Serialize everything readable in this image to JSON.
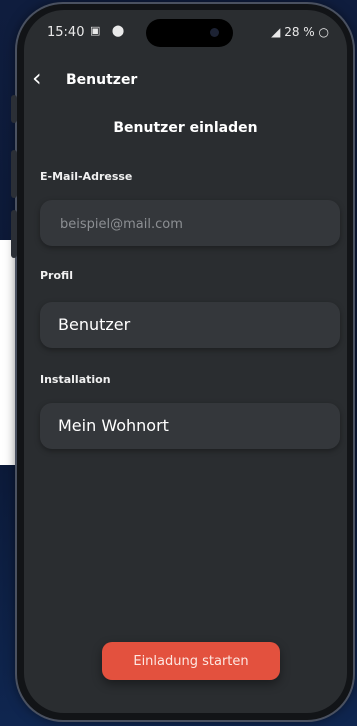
{
  "status": {
    "time": "15:40",
    "left_icons": "▣ ⬤",
    "signal_battery": "◢ 28 % ○"
  },
  "header": {
    "back_icon": "chevron-left-icon",
    "title": "Benutzer"
  },
  "page": {
    "title": "Benutzer einladen"
  },
  "form": {
    "email_label": "E-Mail-Adresse",
    "email_placeholder": "beispiel@mail.com",
    "profile_label": "Profil",
    "profile_value": "Benutzer",
    "installation_label": "Installation",
    "installation_value": "Mein Wohnort"
  },
  "actions": {
    "submit_label": "Einladung starten"
  },
  "colors": {
    "screen_bg": "#2a2d30",
    "field_bg": "#34373b",
    "cta_bg": "#e3513e"
  }
}
